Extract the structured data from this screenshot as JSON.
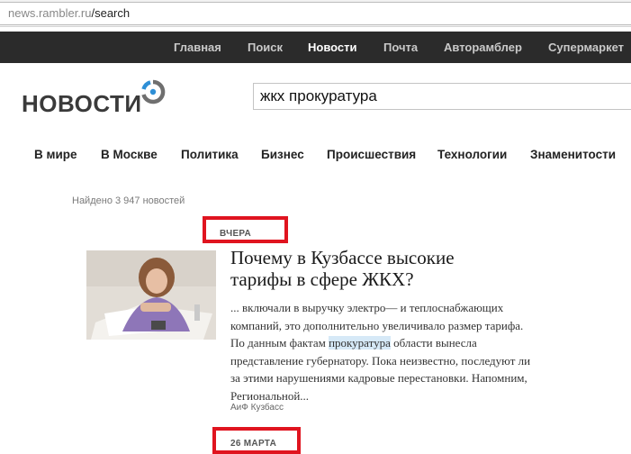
{
  "browser": {
    "url_host": "news.rambler.ru",
    "url_path": "/search"
  },
  "topnav": [
    "Главная",
    "Поиск",
    "Новости",
    "Почта",
    "Авторамблер",
    "Супермаркет"
  ],
  "logo": {
    "text": "НОВОСТИ"
  },
  "search": {
    "value": "жкх прокуратура"
  },
  "categories": [
    "В мире",
    "В Москве",
    "Политика",
    "Бизнес",
    "Происшествия",
    "Технологии",
    "Знаменитости"
  ],
  "results": {
    "found_text": "Найдено 3 947 новостей",
    "date1": "ВЧЕРА",
    "date2": "26 МАРТА",
    "article": {
      "title": "Почему в Кузбассе высокие тарифы в сфере ЖКХ?",
      "snippet_before": "... включали в выручку электро— и теплоснабжающих компаний, это дополнительно увеличивало размер тарифа. По данным фактам ",
      "snippet_highlight": "прокуратура",
      "snippet_after": " области вынесла представление губернатору. Пока неизвестно, последуют ли за этими нарушениями кадровые перестановки. Напомним, Региональной...",
      "source": "АиФ Кузбасс"
    }
  },
  "colors": {
    "topnav_bg": "#2b2b2b",
    "highlight_box": "#e0141f",
    "term_highlight": "#d6e9f7"
  }
}
